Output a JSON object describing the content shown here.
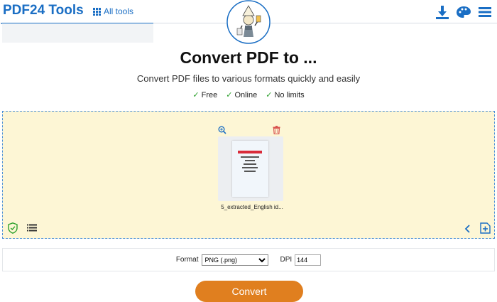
{
  "header": {
    "brand": "PDF24 Tools",
    "all_tools_label": "All tools",
    "icons": [
      "grid-icon",
      "download-icon",
      "palette-icon",
      "menu-icon"
    ],
    "accent_color": "#1a6ec4"
  },
  "page": {
    "title": "Convert PDF to ...",
    "subtitle": "Convert PDF files to various formats quickly and easily",
    "features": [
      "Free",
      "Online",
      "No limits"
    ]
  },
  "dropzone": {
    "background": "#fdf6d5",
    "file": {
      "name": "5_extracted_English id..."
    },
    "icons": [
      "zoom-icon",
      "trash-icon",
      "shield-icon",
      "list-icon",
      "chevron-left-icon",
      "add-file-icon"
    ]
  },
  "options": {
    "format_label": "Format",
    "format_value": "PNG (.png)",
    "dpi_label": "DPI",
    "dpi_value": "144"
  },
  "actions": {
    "convert_label": "Convert",
    "convert_color": "#e07f1f"
  }
}
